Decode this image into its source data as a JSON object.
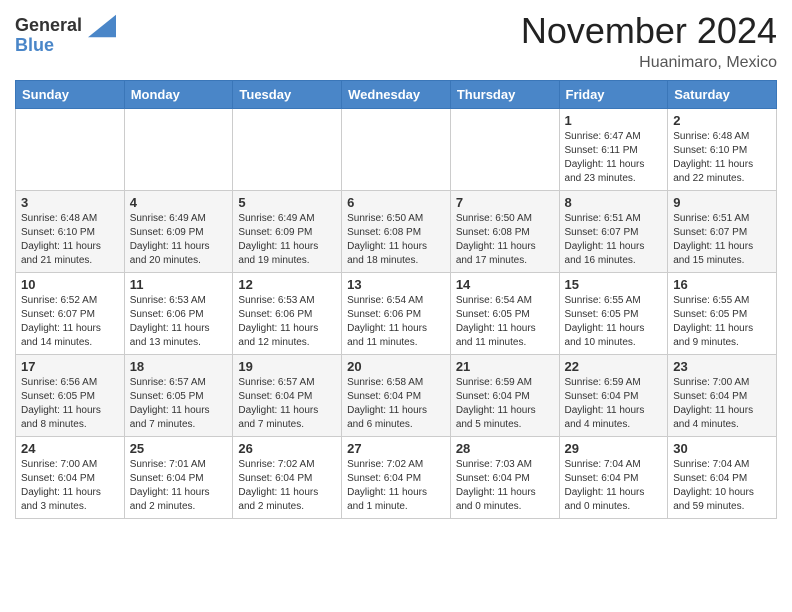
{
  "header": {
    "logo_line1": "General",
    "logo_line2": "Blue",
    "month": "November 2024",
    "location": "Huanimaro, Mexico"
  },
  "weekdays": [
    "Sunday",
    "Monday",
    "Tuesday",
    "Wednesday",
    "Thursday",
    "Friday",
    "Saturday"
  ],
  "weeks": [
    [
      {
        "day": "",
        "detail": ""
      },
      {
        "day": "",
        "detail": ""
      },
      {
        "day": "",
        "detail": ""
      },
      {
        "day": "",
        "detail": ""
      },
      {
        "day": "",
        "detail": ""
      },
      {
        "day": "1",
        "detail": "Sunrise: 6:47 AM\nSunset: 6:11 PM\nDaylight: 11 hours\nand 23 minutes."
      },
      {
        "day": "2",
        "detail": "Sunrise: 6:48 AM\nSunset: 6:10 PM\nDaylight: 11 hours\nand 22 minutes."
      }
    ],
    [
      {
        "day": "3",
        "detail": "Sunrise: 6:48 AM\nSunset: 6:10 PM\nDaylight: 11 hours\nand 21 minutes."
      },
      {
        "day": "4",
        "detail": "Sunrise: 6:49 AM\nSunset: 6:09 PM\nDaylight: 11 hours\nand 20 minutes."
      },
      {
        "day": "5",
        "detail": "Sunrise: 6:49 AM\nSunset: 6:09 PM\nDaylight: 11 hours\nand 19 minutes."
      },
      {
        "day": "6",
        "detail": "Sunrise: 6:50 AM\nSunset: 6:08 PM\nDaylight: 11 hours\nand 18 minutes."
      },
      {
        "day": "7",
        "detail": "Sunrise: 6:50 AM\nSunset: 6:08 PM\nDaylight: 11 hours\nand 17 minutes."
      },
      {
        "day": "8",
        "detail": "Sunrise: 6:51 AM\nSunset: 6:07 PM\nDaylight: 11 hours\nand 16 minutes."
      },
      {
        "day": "9",
        "detail": "Sunrise: 6:51 AM\nSunset: 6:07 PM\nDaylight: 11 hours\nand 15 minutes."
      }
    ],
    [
      {
        "day": "10",
        "detail": "Sunrise: 6:52 AM\nSunset: 6:07 PM\nDaylight: 11 hours\nand 14 minutes."
      },
      {
        "day": "11",
        "detail": "Sunrise: 6:53 AM\nSunset: 6:06 PM\nDaylight: 11 hours\nand 13 minutes."
      },
      {
        "day": "12",
        "detail": "Sunrise: 6:53 AM\nSunset: 6:06 PM\nDaylight: 11 hours\nand 12 minutes."
      },
      {
        "day": "13",
        "detail": "Sunrise: 6:54 AM\nSunset: 6:06 PM\nDaylight: 11 hours\nand 11 minutes."
      },
      {
        "day": "14",
        "detail": "Sunrise: 6:54 AM\nSunset: 6:05 PM\nDaylight: 11 hours\nand 11 minutes."
      },
      {
        "day": "15",
        "detail": "Sunrise: 6:55 AM\nSunset: 6:05 PM\nDaylight: 11 hours\nand 10 minutes."
      },
      {
        "day": "16",
        "detail": "Sunrise: 6:55 AM\nSunset: 6:05 PM\nDaylight: 11 hours\nand 9 minutes."
      }
    ],
    [
      {
        "day": "17",
        "detail": "Sunrise: 6:56 AM\nSunset: 6:05 PM\nDaylight: 11 hours\nand 8 minutes."
      },
      {
        "day": "18",
        "detail": "Sunrise: 6:57 AM\nSunset: 6:05 PM\nDaylight: 11 hours\nand 7 minutes."
      },
      {
        "day": "19",
        "detail": "Sunrise: 6:57 AM\nSunset: 6:04 PM\nDaylight: 11 hours\nand 7 minutes."
      },
      {
        "day": "20",
        "detail": "Sunrise: 6:58 AM\nSunset: 6:04 PM\nDaylight: 11 hours\nand 6 minutes."
      },
      {
        "day": "21",
        "detail": "Sunrise: 6:59 AM\nSunset: 6:04 PM\nDaylight: 11 hours\nand 5 minutes."
      },
      {
        "day": "22",
        "detail": "Sunrise: 6:59 AM\nSunset: 6:04 PM\nDaylight: 11 hours\nand 4 minutes."
      },
      {
        "day": "23",
        "detail": "Sunrise: 7:00 AM\nSunset: 6:04 PM\nDaylight: 11 hours\nand 4 minutes."
      }
    ],
    [
      {
        "day": "24",
        "detail": "Sunrise: 7:00 AM\nSunset: 6:04 PM\nDaylight: 11 hours\nand 3 minutes."
      },
      {
        "day": "25",
        "detail": "Sunrise: 7:01 AM\nSunset: 6:04 PM\nDaylight: 11 hours\nand 2 minutes."
      },
      {
        "day": "26",
        "detail": "Sunrise: 7:02 AM\nSunset: 6:04 PM\nDaylight: 11 hours\nand 2 minutes."
      },
      {
        "day": "27",
        "detail": "Sunrise: 7:02 AM\nSunset: 6:04 PM\nDaylight: 11 hours\nand 1 minute."
      },
      {
        "day": "28",
        "detail": "Sunrise: 7:03 AM\nSunset: 6:04 PM\nDaylight: 11 hours\nand 0 minutes."
      },
      {
        "day": "29",
        "detail": "Sunrise: 7:04 AM\nSunset: 6:04 PM\nDaylight: 11 hours\nand 0 minutes."
      },
      {
        "day": "30",
        "detail": "Sunrise: 7:04 AM\nSunset: 6:04 PM\nDaylight: 10 hours\nand 59 minutes."
      }
    ]
  ]
}
